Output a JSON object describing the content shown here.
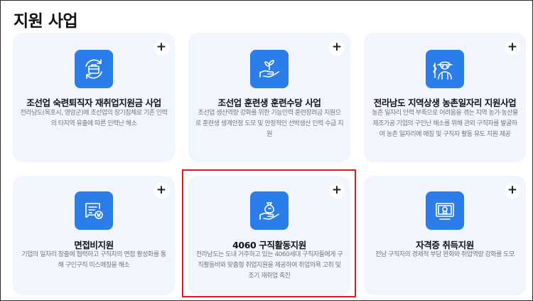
{
  "page": {
    "title": "지원 사업"
  },
  "colors": {
    "accent": "#2b7de9",
    "card_bg": "#f1f5fe",
    "highlight": "#e0191f"
  },
  "cards": [
    {
      "title": "조선업 숙련퇴직자 재취업지원금 사업",
      "desc": "전라남도(목포시, 영암군)에 조선업의 장기침체로 기존 인력의 타지역 유출에 따른 인력난 해소",
      "icon": "briefcase-cycle-icon",
      "action": "+"
    },
    {
      "title": "조선업 훈련생 훈련수당 사업",
      "desc": "조선업 생산역량 강화를 위한 기능인력 훈련장려금 지원으로 훈련생 생계안정 도모 및 안정적인 선박생산 인력 수급 지원",
      "icon": "hand-sprout-icon",
      "action": "+"
    },
    {
      "title": "전라남도 지역상생 농촌일자리 지원사업",
      "desc": "농촌 일자리 인력 부족으로 어려움을 겪는 지역 농가·농산물 제조가공 기업의 구인난 해소를 위해 관외 구직자를 발굴하여 농촌 일자리에 매칭 및 구직자 활동 유도 지원 제공",
      "icon": "farmer-icon",
      "action": "+"
    },
    {
      "title": "면접비지원",
      "desc": "기업의 일자리 창출에 협력하고 구직자의 면접 활성화를 통해 구인구직 미스매칭을 해소",
      "icon": "document-coin-icon",
      "action": "+"
    },
    {
      "title": "4060 구직활동지원",
      "desc": "전라남도는 도내 거주하고 있는 4060세대 구직자들에게 구직활동비와 맞춤형 취업지원을 제공하여 취업의욕 고취 및 조기 재취업 촉진",
      "icon": "hand-money-bag-icon",
      "action": "+"
    },
    {
      "title": "자격증 취득지원",
      "desc": "전남 구직자의 경제적 부담 완화와 취업역량 강화를 도모",
      "icon": "certificate-icon",
      "action": "+"
    }
  ]
}
